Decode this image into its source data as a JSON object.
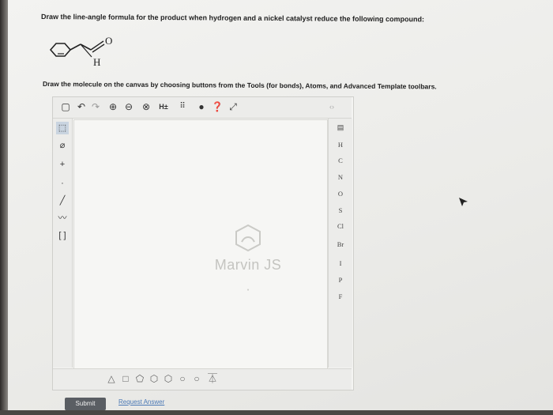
{
  "question": {
    "text": "Draw the line-angle formula for the product when hydrogen and a nickel catalyst reduce the following compound:"
  },
  "molecule": {
    "atom_o": "O",
    "atom_h": "H"
  },
  "instruction": {
    "text": "Draw the molecule on the canvas by choosing buttons from the Tools (for bonds), Atoms, and Advanced Template toolbars."
  },
  "editor": {
    "toolbar_top": {
      "h_toggle_label": "H±"
    },
    "atoms": [
      "H",
      "C",
      "N",
      "O",
      "S",
      "Cl",
      "Br",
      "I",
      "P",
      "F"
    ],
    "watermark": "Marvin JS"
  },
  "actions": {
    "submit_label": "Submit",
    "request_answer_label": "Request Answer"
  },
  "colors": {
    "submit_bg": "#5a5e63",
    "link": "#4a78b5"
  }
}
